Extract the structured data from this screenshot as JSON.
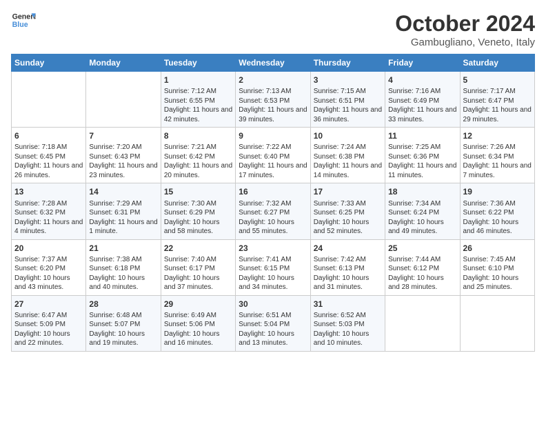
{
  "header": {
    "logo_line1": "General",
    "logo_line2": "Blue",
    "title": "October 2024",
    "subtitle": "Gambugliano, Veneto, Italy"
  },
  "weekdays": [
    "Sunday",
    "Monday",
    "Tuesday",
    "Wednesday",
    "Thursday",
    "Friday",
    "Saturday"
  ],
  "weeks": [
    [
      {
        "day": "",
        "info": ""
      },
      {
        "day": "",
        "info": ""
      },
      {
        "day": "1",
        "info": "Sunrise: 7:12 AM\nSunset: 6:55 PM\nDaylight: 11 hours and 42 minutes."
      },
      {
        "day": "2",
        "info": "Sunrise: 7:13 AM\nSunset: 6:53 PM\nDaylight: 11 hours and 39 minutes."
      },
      {
        "day": "3",
        "info": "Sunrise: 7:15 AM\nSunset: 6:51 PM\nDaylight: 11 hours and 36 minutes."
      },
      {
        "day": "4",
        "info": "Sunrise: 7:16 AM\nSunset: 6:49 PM\nDaylight: 11 hours and 33 minutes."
      },
      {
        "day": "5",
        "info": "Sunrise: 7:17 AM\nSunset: 6:47 PM\nDaylight: 11 hours and 29 minutes."
      }
    ],
    [
      {
        "day": "6",
        "info": "Sunrise: 7:18 AM\nSunset: 6:45 PM\nDaylight: 11 hours and 26 minutes."
      },
      {
        "day": "7",
        "info": "Sunrise: 7:20 AM\nSunset: 6:43 PM\nDaylight: 11 hours and 23 minutes."
      },
      {
        "day": "8",
        "info": "Sunrise: 7:21 AM\nSunset: 6:42 PM\nDaylight: 11 hours and 20 minutes."
      },
      {
        "day": "9",
        "info": "Sunrise: 7:22 AM\nSunset: 6:40 PM\nDaylight: 11 hours and 17 minutes."
      },
      {
        "day": "10",
        "info": "Sunrise: 7:24 AM\nSunset: 6:38 PM\nDaylight: 11 hours and 14 minutes."
      },
      {
        "day": "11",
        "info": "Sunrise: 7:25 AM\nSunset: 6:36 PM\nDaylight: 11 hours and 11 minutes."
      },
      {
        "day": "12",
        "info": "Sunrise: 7:26 AM\nSunset: 6:34 PM\nDaylight: 11 hours and 7 minutes."
      }
    ],
    [
      {
        "day": "13",
        "info": "Sunrise: 7:28 AM\nSunset: 6:32 PM\nDaylight: 11 hours and 4 minutes."
      },
      {
        "day": "14",
        "info": "Sunrise: 7:29 AM\nSunset: 6:31 PM\nDaylight: 11 hours and 1 minute."
      },
      {
        "day": "15",
        "info": "Sunrise: 7:30 AM\nSunset: 6:29 PM\nDaylight: 10 hours and 58 minutes."
      },
      {
        "day": "16",
        "info": "Sunrise: 7:32 AM\nSunset: 6:27 PM\nDaylight: 10 hours and 55 minutes."
      },
      {
        "day": "17",
        "info": "Sunrise: 7:33 AM\nSunset: 6:25 PM\nDaylight: 10 hours and 52 minutes."
      },
      {
        "day": "18",
        "info": "Sunrise: 7:34 AM\nSunset: 6:24 PM\nDaylight: 10 hours and 49 minutes."
      },
      {
        "day": "19",
        "info": "Sunrise: 7:36 AM\nSunset: 6:22 PM\nDaylight: 10 hours and 46 minutes."
      }
    ],
    [
      {
        "day": "20",
        "info": "Sunrise: 7:37 AM\nSunset: 6:20 PM\nDaylight: 10 hours and 43 minutes."
      },
      {
        "day": "21",
        "info": "Sunrise: 7:38 AM\nSunset: 6:18 PM\nDaylight: 10 hours and 40 minutes."
      },
      {
        "day": "22",
        "info": "Sunrise: 7:40 AM\nSunset: 6:17 PM\nDaylight: 10 hours and 37 minutes."
      },
      {
        "day": "23",
        "info": "Sunrise: 7:41 AM\nSunset: 6:15 PM\nDaylight: 10 hours and 34 minutes."
      },
      {
        "day": "24",
        "info": "Sunrise: 7:42 AM\nSunset: 6:13 PM\nDaylight: 10 hours and 31 minutes."
      },
      {
        "day": "25",
        "info": "Sunrise: 7:44 AM\nSunset: 6:12 PM\nDaylight: 10 hours and 28 minutes."
      },
      {
        "day": "26",
        "info": "Sunrise: 7:45 AM\nSunset: 6:10 PM\nDaylight: 10 hours and 25 minutes."
      }
    ],
    [
      {
        "day": "27",
        "info": "Sunrise: 6:47 AM\nSunset: 5:09 PM\nDaylight: 10 hours and 22 minutes."
      },
      {
        "day": "28",
        "info": "Sunrise: 6:48 AM\nSunset: 5:07 PM\nDaylight: 10 hours and 19 minutes."
      },
      {
        "day": "29",
        "info": "Sunrise: 6:49 AM\nSunset: 5:06 PM\nDaylight: 10 hours and 16 minutes."
      },
      {
        "day": "30",
        "info": "Sunrise: 6:51 AM\nSunset: 5:04 PM\nDaylight: 10 hours and 13 minutes."
      },
      {
        "day": "31",
        "info": "Sunrise: 6:52 AM\nSunset: 5:03 PM\nDaylight: 10 hours and 10 minutes."
      },
      {
        "day": "",
        "info": ""
      },
      {
        "day": "",
        "info": ""
      }
    ]
  ]
}
